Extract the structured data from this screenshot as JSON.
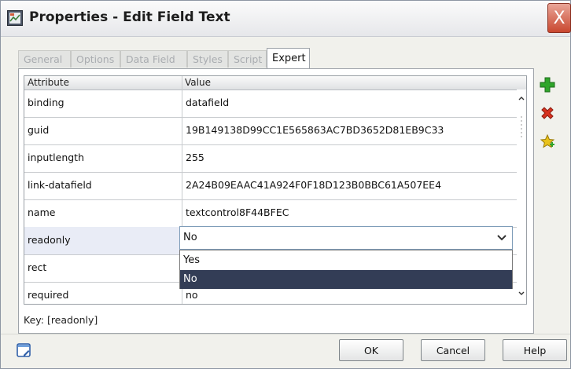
{
  "window": {
    "title": "Properties - Edit Field Text",
    "close_glyph": "X"
  },
  "tabs": [
    {
      "label": "General",
      "active": false
    },
    {
      "label": "Options",
      "active": false
    },
    {
      "label": "Data Field",
      "active": false
    },
    {
      "label": "Styles",
      "active": false
    },
    {
      "label": "Script",
      "active": false
    },
    {
      "label": "Expert",
      "active": true
    }
  ],
  "grid": {
    "headers": [
      "Attribute",
      "Value"
    ],
    "rows": [
      {
        "attribute": "binding",
        "value": "datafield"
      },
      {
        "attribute": "guid",
        "value": "19B149138D99CC1E565863AC7BD3652D81EB9C33"
      },
      {
        "attribute": "inputlength",
        "value": "255"
      },
      {
        "attribute": "link-datafield",
        "value": "2A24B09EAAC41A924F0F18D123B0BBC61A507EE4"
      },
      {
        "attribute": "name",
        "value": "textcontrol8F44BFEC"
      },
      {
        "attribute": "readonly",
        "value": ""
      },
      {
        "attribute": "rect",
        "value": ""
      },
      {
        "attribute": "required",
        "value": "no"
      }
    ]
  },
  "combo": {
    "selected": "No",
    "options": [
      "Yes",
      "No"
    ],
    "highlighted": "No"
  },
  "key_text": "Key: [readonly]",
  "side_icons": [
    "add-icon",
    "delete-icon",
    "favorite-add-icon"
  ],
  "buttons": {
    "ok": "OK",
    "cancel": "Cancel",
    "help": "Help"
  },
  "colors": {
    "highlight": "#333d56",
    "add": "#2fa52a",
    "delete": "#d8321f",
    "star": "#e9c21b"
  }
}
